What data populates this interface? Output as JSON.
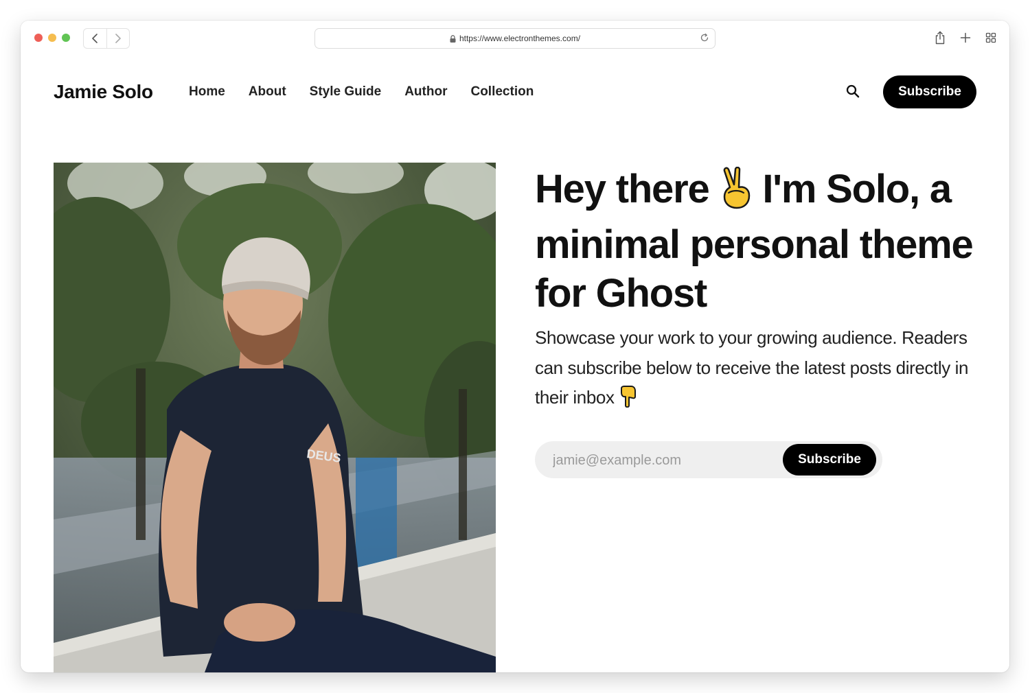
{
  "browser": {
    "url": "https://www.electronthemes.com/"
  },
  "site": {
    "brand": "Jamie Solo",
    "nav": [
      "Home",
      "About",
      "Style Guide",
      "Author",
      "Collection"
    ],
    "subscribe_label": "Subscribe"
  },
  "hero": {
    "title_part1": "Hey there",
    "title_part2": "I'm Solo, a minimal personal theme for Ghost",
    "title_emoji": "victory-hand-icon",
    "description": "Showcase your work to your growing audience. Readers can subscribe below to receive the latest posts directly in their inbox",
    "desc_emoji": "pointing-down-icon",
    "email_placeholder": "jamie@example.com",
    "subscribe_label": "Subscribe",
    "photo": "person-portrait-photo"
  },
  "icons": {
    "back": "chevron-left-icon",
    "forward": "chevron-right-icon",
    "lock": "lock-icon",
    "reload": "reload-icon",
    "share": "share-icon",
    "new_tab": "plus-icon",
    "tabs": "tab-overview-icon",
    "search": "search-icon"
  },
  "colors": {
    "accent": "#000000",
    "traffic_red": "#ee5f57",
    "traffic_yellow": "#f5bd4f",
    "traffic_green": "#61c454",
    "emoji_yellow": "#f7c531"
  }
}
